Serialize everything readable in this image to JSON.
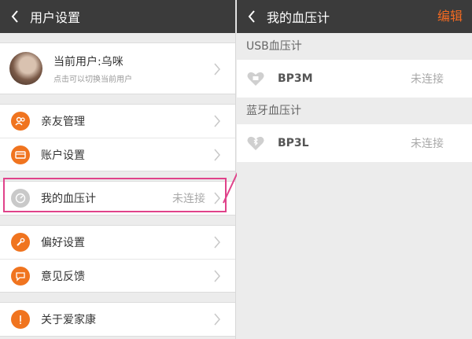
{
  "left": {
    "title": "用户设置",
    "user": {
      "name": "当前用户:乌咪",
      "hint": "点击可以切换当前用户"
    },
    "group1": [
      {
        "label": "亲友管理",
        "icon": "people-icon"
      },
      {
        "label": "账户设置",
        "icon": "card-icon"
      }
    ],
    "monitor": {
      "label": "我的血压计",
      "status": "未连接",
      "icon": "gauge-icon"
    },
    "group3": [
      {
        "label": "偏好设置",
        "icon": "wrench-icon"
      },
      {
        "label": "意见反馈",
        "icon": "chat-icon"
      }
    ],
    "about": {
      "label": "关于爱家康",
      "icon": "info-icon"
    }
  },
  "right": {
    "title": "我的血压计",
    "edit_label": "编辑",
    "usb_section": "USB血压计",
    "usb_device": {
      "name": "BP3M",
      "status": "未连接"
    },
    "bt_section": "蓝牙血压计",
    "bt_device": {
      "name": "BP3L",
      "status": "未连接"
    }
  },
  "colors": {
    "accent": "#f0741f",
    "highlight": "#e0428a",
    "topbar": "#3b3b3b"
  }
}
